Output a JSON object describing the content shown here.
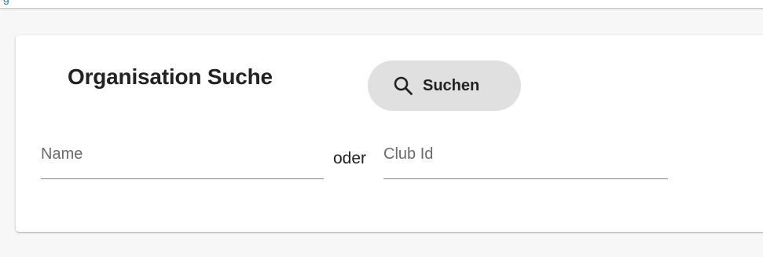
{
  "top_bar": {
    "link_fragment": "g"
  },
  "card": {
    "title": "Organisation Suche",
    "search_button": {
      "label": "Suchen",
      "icon": "search-icon"
    },
    "name_field": {
      "placeholder": "Name",
      "value": ""
    },
    "separator": "oder",
    "club_id_field": {
      "placeholder": "Club Id",
      "value": ""
    }
  },
  "colors": {
    "page_background": "#f7f7f7",
    "card_background": "#ffffff",
    "button_background": "#e0e0e0",
    "link": "#2a7bd6",
    "text": "#222222",
    "placeholder": "#6b6b6b"
  }
}
